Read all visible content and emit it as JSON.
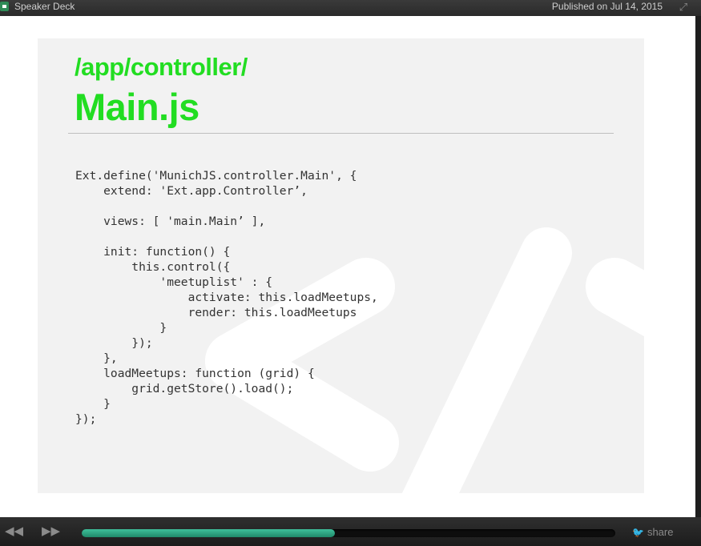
{
  "header": {
    "brand": "Speaker Deck",
    "published": "Published on Jul 14, 2015",
    "icons": {
      "logo": "speakerdeck-logo-icon",
      "expand": "expand-icon"
    }
  },
  "slide": {
    "path": "/app/controller/",
    "filename": "Main.js",
    "code": "Ext.define('MunichJS.controller.Main', {\n    extend: 'Ext.app.Controller’,\n\n    views: [ 'main.Main’ ],\n\n    init: function() {\n        this.control({\n            'meetuplist' : {\n                activate: this.loadMeetups,\n                render: this.loadMeetups\n            }\n        });\n    },\n    loadMeetups: function (grid) {\n        grid.getStore().load();\n    }\n});",
    "colors": {
      "accent": "#22dd22",
      "background": "#f2f2f2"
    }
  },
  "footer": {
    "progress_percent": 47.5,
    "share_label": "share",
    "icons": {
      "prev": "rewind-icon",
      "next": "fast-forward-icon",
      "share": "twitter-bird-icon"
    }
  }
}
